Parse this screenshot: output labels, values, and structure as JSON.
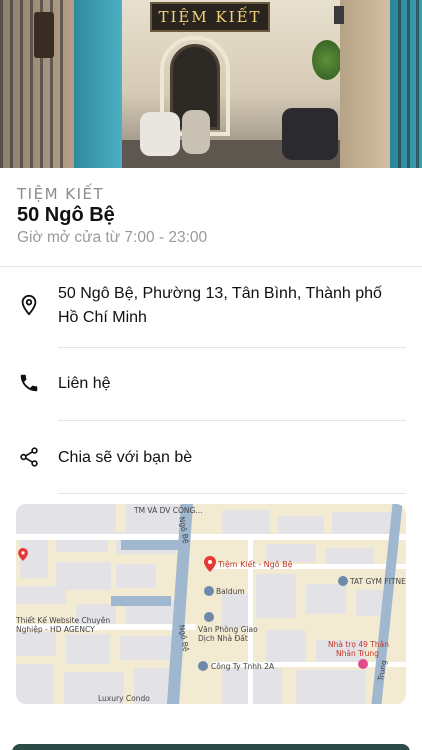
{
  "hero": {
    "sign_text": "TIỆM KIẾT"
  },
  "place": {
    "brand": "TIỆM KIẾT",
    "name": "50 Ngô Bệ",
    "hours": "Giờ mở cửa từ 7:00 - 23:00"
  },
  "details": {
    "address": "50 Ngô Bệ, Phường 13, Tân Bình, Thành phố Hồ Chí Minh",
    "contact_label": "Liên hệ",
    "share_label": "Chia sẽ với bạn bè"
  },
  "map": {
    "marker_label": "Tiệm Kiết - Ngô Bệ",
    "street_vertical": "Ngô Bệ",
    "street_vertical_2": "Ngô Bệ",
    "top_label": "TM VÀ DV CÔNG...",
    "poi_baldum": "Baldum",
    "poi_van_phong": "Văn Phòng Giao",
    "poi_van_phong_2": "Dịch Nhà Đất",
    "poi_cong_ty": "Công Ty Tnhh 2A",
    "poi_gym": "TAT GYM FITNESS",
    "poi_nha_tro": "Nhà trọ 49 Thân",
    "poi_nha_tro_2": "Nhân Trung",
    "poi_website": "Thiết Kế Website Chuyên",
    "poi_website_2": "Nghiệp - HD AGENCY",
    "poi_luxury": "Luxury Condo",
    "street_trung": "Trung"
  },
  "colors": {
    "accent_dark": "#2b4b47",
    "marker_red": "#e53935",
    "muted_text": "#9a9a9a"
  },
  "icons": {
    "address": "location-pin-icon",
    "contact": "phone-icon",
    "share": "share-icon"
  }
}
